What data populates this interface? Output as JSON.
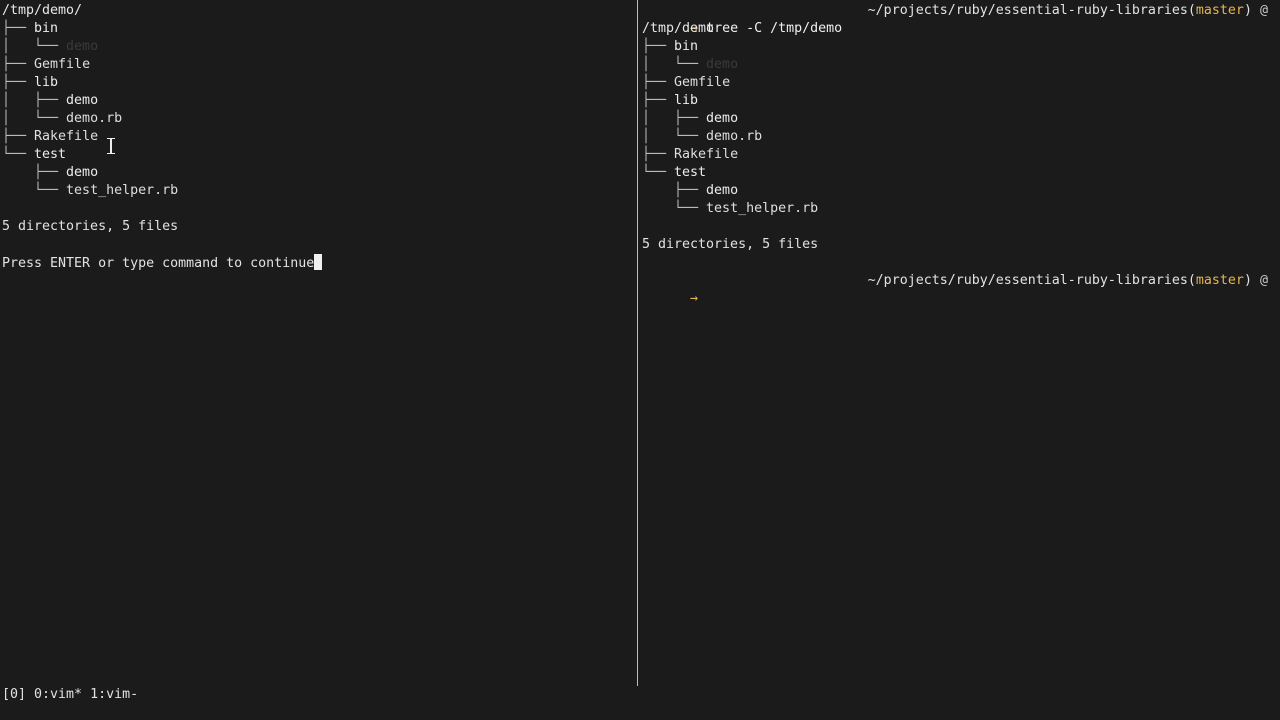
{
  "left_pane": {
    "root": "/tmp/demo/",
    "tree": [
      {
        "guide": "├── ",
        "name": "bin",
        "kind": "dir"
      },
      {
        "guide": "│   └── ",
        "name": "demo",
        "kind": "faint"
      },
      {
        "guide": "├── ",
        "name": "Gemfile",
        "kind": "file"
      },
      {
        "guide": "├── ",
        "name": "lib",
        "kind": "dir"
      },
      {
        "guide": "│   ├── ",
        "name": "demo",
        "kind": "dir"
      },
      {
        "guide": "│   └── ",
        "name": "demo.rb",
        "kind": "file"
      },
      {
        "guide": "├── ",
        "name": "Rakefile",
        "kind": "file"
      },
      {
        "guide": "└── ",
        "name": "test",
        "kind": "dir"
      },
      {
        "guide": "    ├── ",
        "name": "demo",
        "kind": "dir"
      },
      {
        "guide": "    └── ",
        "name": "test_helper.rb",
        "kind": "file"
      }
    ],
    "summary": "5 directories, 5 files",
    "press_enter": "Press ENTER or type command to continue"
  },
  "right_pane": {
    "prompt_arrow": "→",
    "command": "tree -C /tmp/demo",
    "cwd": "~/projects/ruby/essential-ruby-libraries",
    "branch_open": "(",
    "branch": "master",
    "branch_close": ")",
    "at_symbol": "@",
    "root": "/tmp/demo",
    "tree": [
      {
        "guide": "├── ",
        "name": "bin",
        "kind": "dir"
      },
      {
        "guide": "│   └── ",
        "name": "demo",
        "kind": "faint"
      },
      {
        "guide": "├── ",
        "name": "Gemfile",
        "kind": "file"
      },
      {
        "guide": "├── ",
        "name": "lib",
        "kind": "dir"
      },
      {
        "guide": "│   ├── ",
        "name": "demo",
        "kind": "dir"
      },
      {
        "guide": "│   └── ",
        "name": "demo.rb",
        "kind": "file"
      },
      {
        "guide": "├── ",
        "name": "Rakefile",
        "kind": "file"
      },
      {
        "guide": "└── ",
        "name": "test",
        "kind": "dir"
      },
      {
        "guide": "    ├── ",
        "name": "demo",
        "kind": "dir"
      },
      {
        "guide": "    └── ",
        "name": "test_helper.rb",
        "kind": "file"
      }
    ],
    "summary": "5 directories, 5 files"
  },
  "statusbar": {
    "session": "[0]",
    "windows": [
      "0:vim*",
      "1:vim-"
    ]
  },
  "colors": {
    "background": "#1b1b1b",
    "foreground": "#e2e2e2",
    "accent": "#e6b450"
  }
}
